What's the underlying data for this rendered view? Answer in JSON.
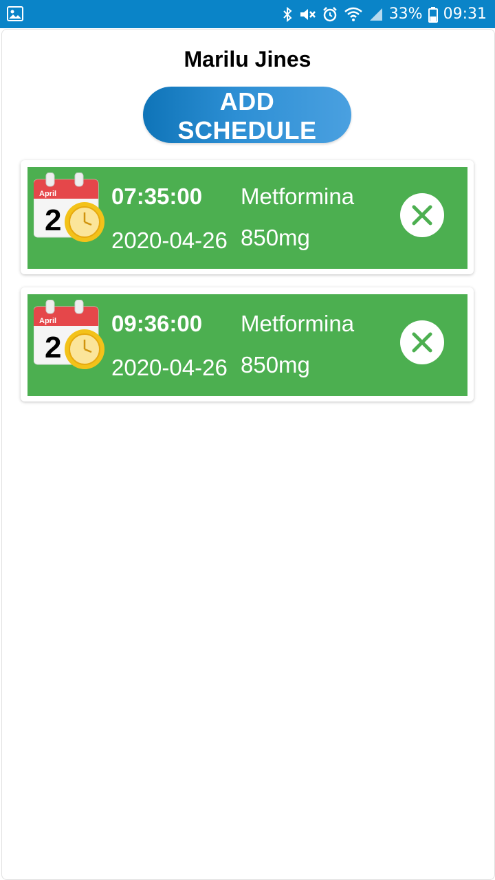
{
  "status_bar": {
    "battery": "33%",
    "time": "09:31",
    "icons": [
      "image-icon",
      "bluetooth-icon",
      "mute-icon",
      "alarm-icon",
      "wifi-icon",
      "signal-icon",
      "battery-icon"
    ]
  },
  "header": {
    "patient_name": "Marilu Jines"
  },
  "actions": {
    "add_schedule_label": "ADD SCHEDULE"
  },
  "schedules": [
    {
      "time": "07:35:00",
      "date": "2020-04-26",
      "medicine": "Metformina",
      "dose": "850mg",
      "icon_month": "April",
      "icon_day": "2"
    },
    {
      "time": "09:36:00",
      "date": "2020-04-26",
      "medicine": "Metformina",
      "dose": "850mg",
      "icon_month": "April",
      "icon_day": "2"
    }
  ],
  "colors": {
    "status_bar": "#0a84c8",
    "card_bg": "#4caf50",
    "button_start": "#0f74b8",
    "button_end": "#4aa0e0"
  }
}
